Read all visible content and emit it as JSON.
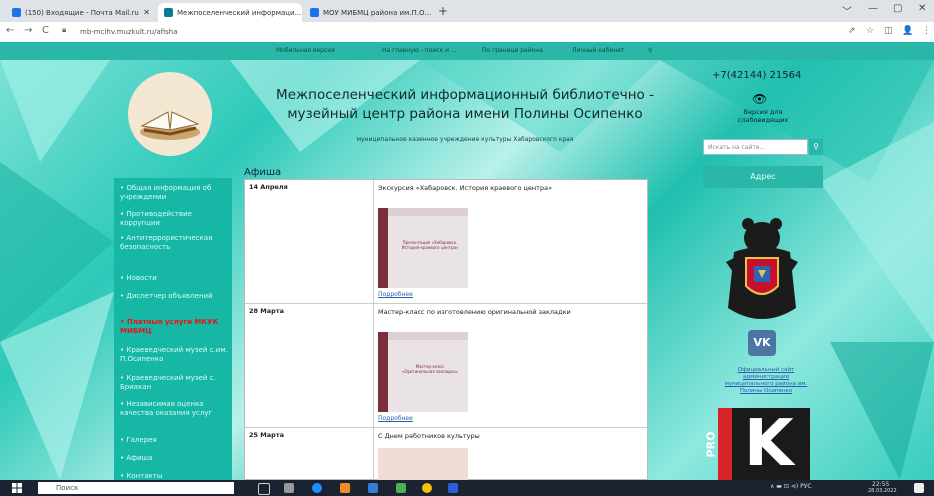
{
  "browser": {
    "tabs": [
      {
        "label": "(150) Входящие - Почта Mail.ru",
        "close": "✕",
        "color": "#1a73e8"
      },
      {
        "label": "Межпоселенческий информаци...",
        "close": "✕",
        "color": "#1a73e8"
      },
      {
        "label": "МОУ МИБМЦ района им.П.О...",
        "close": "✕",
        "color": "#1a73e8"
      }
    ],
    "new_tab": "+",
    "window_controls": [
      "﹀",
      "—",
      "▢",
      "✕"
    ],
    "nav": [
      "←",
      "→",
      "C"
    ],
    "url": "mb-mcihv.muzkult.ru/afisha",
    "right_icons": [
      "⇗",
      "☆",
      "◫",
      "👤",
      "⋮"
    ]
  },
  "site": {
    "top_links": [
      "Мобильная версия",
      "На главную - поиск и ...",
      "По границе района",
      "Личный кабинет",
      "⚲"
    ],
    "title": "Межпоселенческий информационный библиотечно - музейный центр района имени Полины Осипенко",
    "subtitle": "муниципальное казенное учреждение культуры Хабаровского края",
    "phone": "+7(42144) 21564",
    "eye_icon": "👁",
    "blind_version": "Версия для слабовидящих",
    "search_placeholder": "Искать на сайте...",
    "search_button": "⚲",
    "address_button": "Адрес",
    "section_title": "Афиша",
    "sidebar": [
      {
        "label": "• Общая информация об учреждении",
        "highlight": false
      },
      {
        "label": "• Противодействие коррупции",
        "highlight": false
      },
      {
        "label": "• Антитеррористическая безопасность",
        "highlight": false
      },
      {
        "label": "• Новости",
        "highlight": false
      },
      {
        "label": "• Диспетчер объявлений",
        "highlight": false
      },
      {
        "label": "• Платные услуги МКУК МИБМЦ",
        "highlight": true
      },
      {
        "label": "• Краеведческий музей с.им. П.Осипенко",
        "highlight": false
      },
      {
        "label": "• Краеведческий музей с. Бриакан",
        "highlight": false
      },
      {
        "label": "• Независимая оценка качества оказания услуг",
        "highlight": false
      },
      {
        "label": "• Галерея",
        "highlight": false
      },
      {
        "label": "• Афиша",
        "highlight": false
      },
      {
        "label": "• Контакты",
        "highlight": false
      }
    ],
    "events": [
      {
        "date": "14 Апреля",
        "title": "Экскурсия «Хабаровск. История краевого центра»",
        "thumb_caption": "Презентация «Хабаровск. История краевого центра»",
        "more": "Подробнее"
      },
      {
        "date": "28 Марта",
        "title": "Мастер-класс по изготовлению оригинальной закладки",
        "thumb_caption": "Мастер-класс «Оригинальная закладка»",
        "more": "Подробнее"
      },
      {
        "date": "25 Марта",
        "title": "С Днем работников культуры",
        "thumb_caption": "",
        "more": ""
      }
    ],
    "vk_label": "VK",
    "vk_text": "Официальный сайт администрации муниципального района им. Полины Осипенко",
    "prok_pro": "PRO",
    "prok_k": "K"
  },
  "taskbar": {
    "search": "Поиск",
    "tray": "∧  ▬  ⊡  ⊲)  РУС",
    "time": "22:55",
    "date": "28.03.2022"
  },
  "colors": {
    "teal": "#2ab7a8",
    "sidebar": "#17b7a6",
    "highlight": "#e11111",
    "vk": "#4c75a3"
  }
}
